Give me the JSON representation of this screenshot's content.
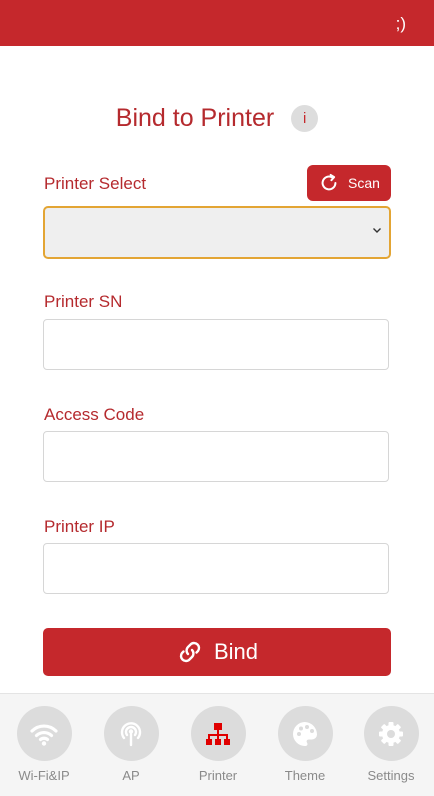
{
  "header": {
    "status_text": ";)"
  },
  "page": {
    "title": "Bind to Printer",
    "info_label": "i"
  },
  "form": {
    "printer_select": {
      "label": "Printer Select",
      "value": ""
    },
    "scan_button": {
      "label": "Scan"
    },
    "printer_sn": {
      "label": "Printer SN",
      "value": "",
      "placeholder": ""
    },
    "access_code": {
      "label": "Access Code",
      "value": "",
      "placeholder": ""
    },
    "printer_ip": {
      "label": "Printer IP",
      "value": "",
      "placeholder": ""
    },
    "bind_button": {
      "label": "Bind"
    }
  },
  "nav": {
    "items": [
      {
        "label": "Wi-Fi&IP",
        "icon": "wifi-icon",
        "active": false
      },
      {
        "label": "AP",
        "icon": "broadcast-tower-icon",
        "active": false
      },
      {
        "label": "Printer",
        "icon": "network-icon",
        "active": true
      },
      {
        "label": "Theme",
        "icon": "palette-icon",
        "active": false
      },
      {
        "label": "Settings",
        "icon": "gear-icon",
        "active": false
      }
    ]
  },
  "colors": {
    "brand_red": "#c5282c",
    "label_red": "#b52a2e",
    "select_focus": "#e3a534",
    "nav_inactive": "#ffffff",
    "nav_active": "#e00000"
  }
}
